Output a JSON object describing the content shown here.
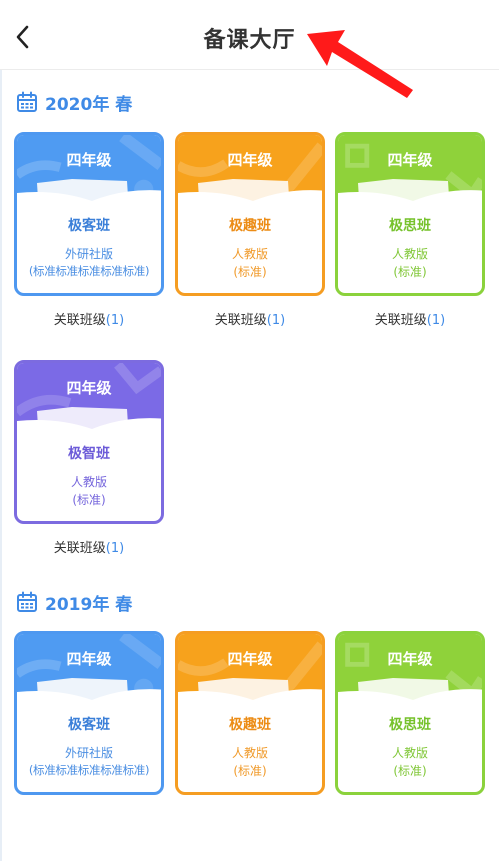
{
  "header": {
    "title": "备课大厅",
    "back_icon": "chevron-left-icon"
  },
  "colors": {
    "blue": "#4f9bf2",
    "orange": "#f7a21c",
    "green": "#8fd23a",
    "purple": "#7b6ae6",
    "accent": "#3f8ae6",
    "arrow": "#ff1a1a"
  },
  "sections": [
    {
      "title": "2020年 春",
      "cards": [
        {
          "grade": "四年级",
          "name": "极客班",
          "edition": "外研社版",
          "sub": "(标准标准标准标准标准)",
          "color": "blue",
          "link_label": "关联班级",
          "link_count": "(1)"
        },
        {
          "grade": "四年级",
          "name": "极趣班",
          "edition": "人教版",
          "sub": "(标准)",
          "color": "orange",
          "link_label": "关联班级",
          "link_count": "(1)"
        },
        {
          "grade": "四年级",
          "name": "极思班",
          "edition": "人教版",
          "sub": "(标准)",
          "color": "green",
          "link_label": "关联班级",
          "link_count": "(1)"
        },
        {
          "grade": "四年级",
          "name": "极智班",
          "edition": "人教版",
          "sub": "(标准)",
          "color": "purple",
          "link_label": "关联班级",
          "link_count": "(1)"
        }
      ]
    },
    {
      "title": "2019年 春",
      "cards": [
        {
          "grade": "四年级",
          "name": "极客班",
          "edition": "外研社版",
          "sub": "(标准标准标准标准标准)",
          "color": "blue"
        },
        {
          "grade": "四年级",
          "name": "极趣班",
          "edition": "人教版",
          "sub": "(标准)",
          "color": "orange"
        },
        {
          "grade": "四年级",
          "name": "极思班",
          "edition": "人教版",
          "sub": "(标准)",
          "color": "green"
        }
      ]
    }
  ]
}
